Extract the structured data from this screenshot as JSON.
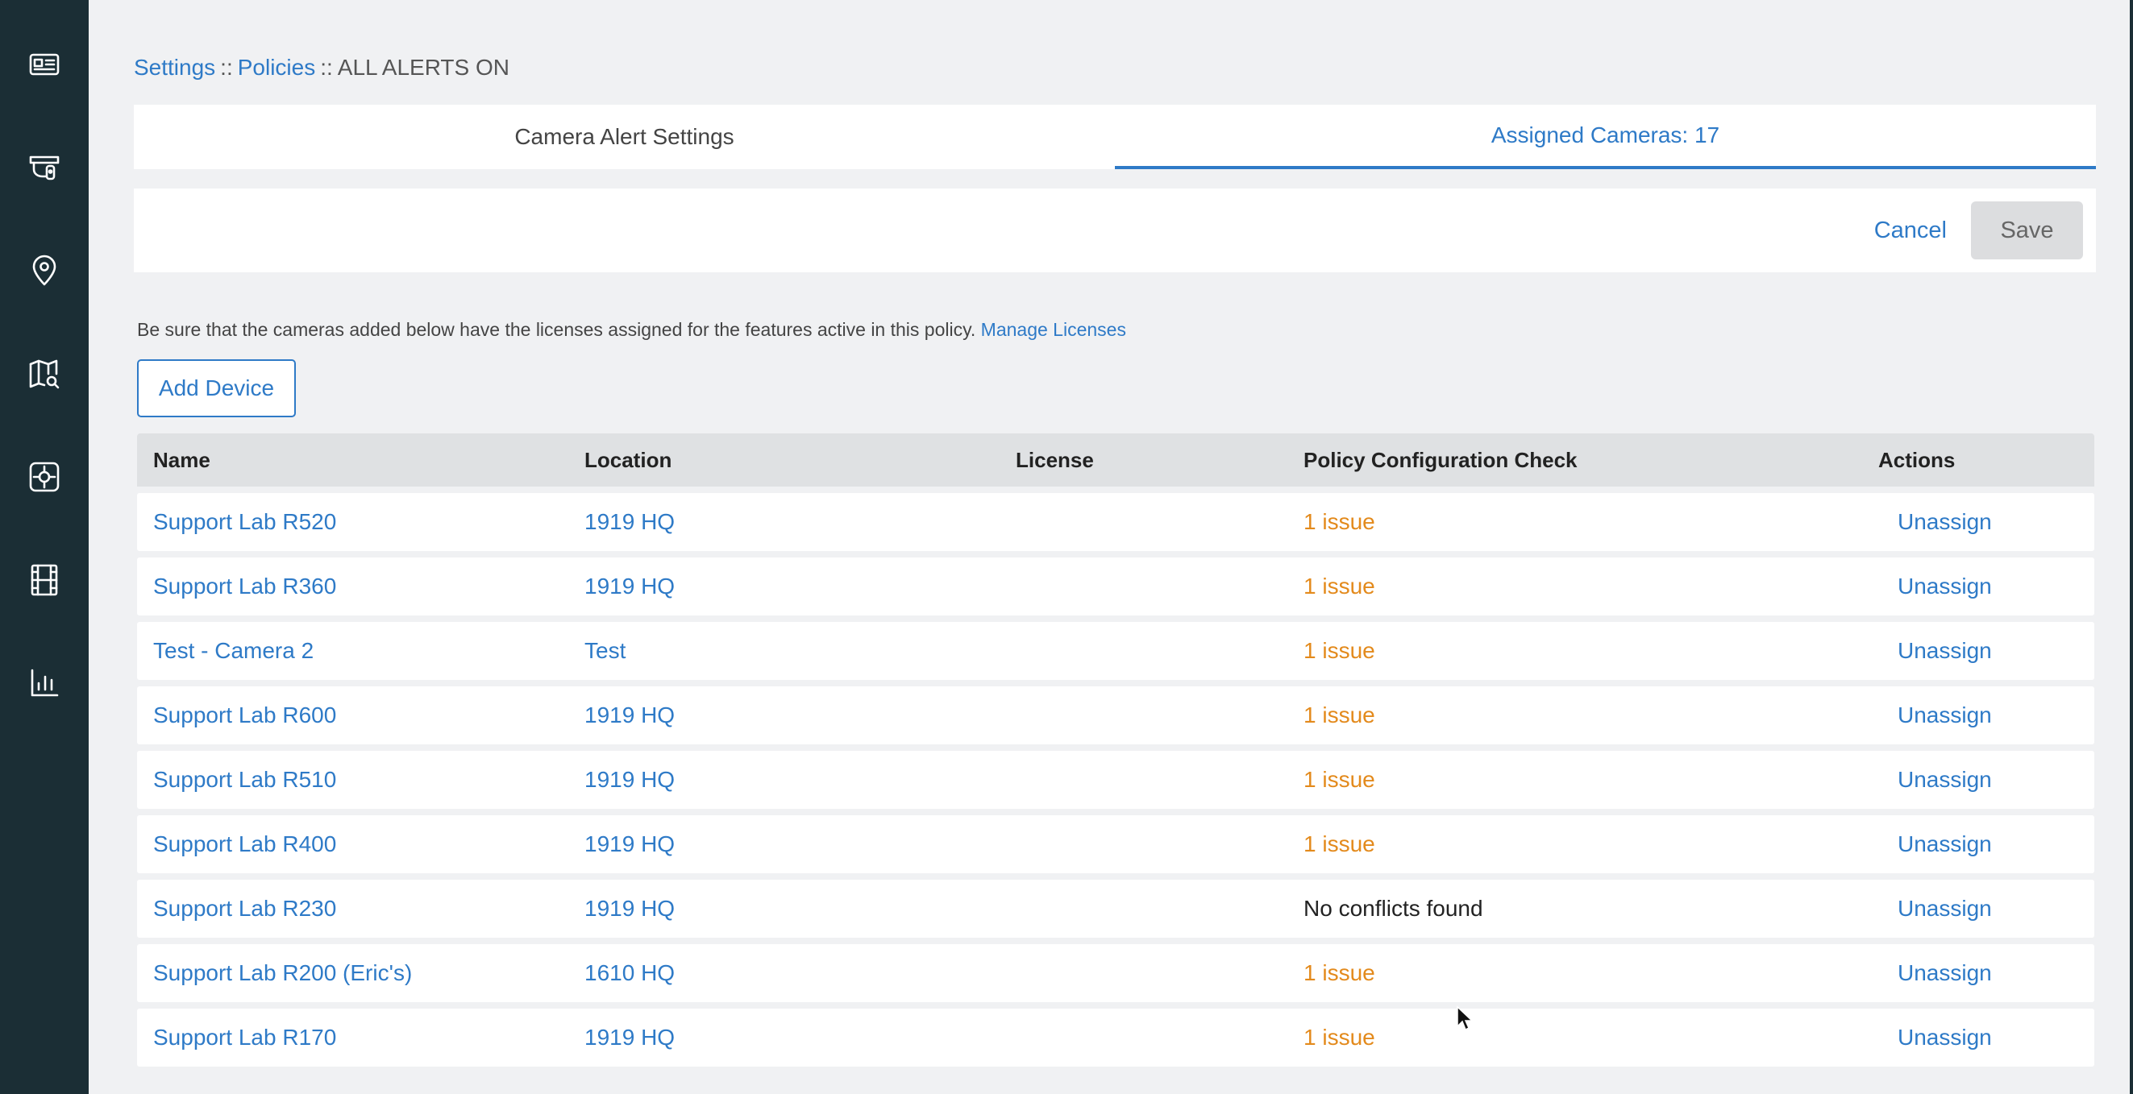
{
  "sidebar": {
    "items": [
      {
        "icon": "dashboard-card-icon"
      },
      {
        "icon": "camera-icon"
      },
      {
        "icon": "location-pin-icon"
      },
      {
        "icon": "map-search-icon"
      },
      {
        "icon": "alert-target-icon"
      },
      {
        "icon": "film-icon"
      },
      {
        "icon": "analytics-chart-icon"
      }
    ]
  },
  "breadcrumb": {
    "settings": "Settings",
    "sep1": "::",
    "policies": "Policies",
    "sep2": "::",
    "current": "ALL ALERTS ON"
  },
  "tabs": {
    "alert_settings": "Camera Alert Settings",
    "assigned_cameras": "Assigned Cameras: 17"
  },
  "actions": {
    "cancel": "Cancel",
    "save": "Save"
  },
  "note": {
    "text": "Be sure that the cameras added below have the licenses assigned for the features active in this policy.",
    "link": "Manage Licenses"
  },
  "add_device": "Add Device",
  "table": {
    "headers": {
      "name": "Name",
      "location": "Location",
      "license": "License",
      "check": "Policy Configuration Check",
      "actions": "Actions"
    },
    "rows": [
      {
        "name": "Support Lab R520",
        "location": "1919 HQ",
        "license": "",
        "check": "1 issue",
        "action": "Unassign"
      },
      {
        "name": "Support Lab R360",
        "location": "1919 HQ",
        "license": "",
        "check": "1 issue",
        "action": "Unassign"
      },
      {
        "name": "Test - Camera 2",
        "location": "Test",
        "license": "",
        "check": "1 issue",
        "action": "Unassign"
      },
      {
        "name": "Support Lab R600",
        "location": "1919 HQ",
        "license": "",
        "check": "1 issue",
        "action": "Unassign"
      },
      {
        "name": "Support Lab R510",
        "location": "1919 HQ",
        "license": "",
        "check": "1 issue",
        "action": "Unassign"
      },
      {
        "name": "Support Lab R400",
        "location": "1919 HQ",
        "license": "",
        "check": "1 issue",
        "action": "Unassign"
      },
      {
        "name": "Support Lab R230",
        "location": "1919 HQ",
        "license": "",
        "check": "No conflicts found",
        "action": "Unassign"
      },
      {
        "name": "Support Lab R200 (Eric's)",
        "location": "1610 HQ",
        "license": "",
        "check": "1 issue",
        "action": "Unassign"
      },
      {
        "name": "Support Lab R170",
        "location": "1919 HQ",
        "license": "",
        "check": "1 issue",
        "action": "Unassign"
      }
    ]
  },
  "colors": {
    "sidebar_bg": "#1b2e35",
    "accent": "#2e7ac7",
    "issue": "#e38a1c",
    "page_bg": "#f0f1f3"
  }
}
